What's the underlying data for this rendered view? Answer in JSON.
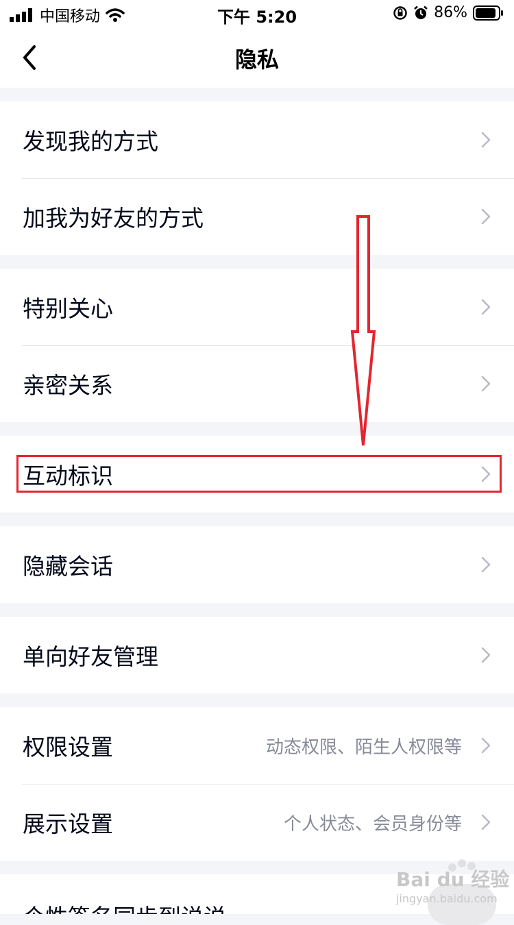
{
  "status_bar": {
    "carrier": "中国移动",
    "time": "下午 5:20",
    "battery": "86%"
  },
  "nav": {
    "title": "隐私"
  },
  "groups": [
    {
      "items": [
        {
          "label": "发现我的方式"
        },
        {
          "label": "加我为好友的方式"
        }
      ]
    },
    {
      "items": [
        {
          "label": "特别关心"
        },
        {
          "label": "亲密关系"
        }
      ]
    },
    {
      "items": [
        {
          "label": "互动标识"
        }
      ]
    },
    {
      "items": [
        {
          "label": "隐藏会话"
        }
      ]
    },
    {
      "items": [
        {
          "label": "单向好友管理"
        }
      ]
    },
    {
      "items": [
        {
          "label": "权限设置",
          "detail": "动态权限、陌生人权限等"
        },
        {
          "label": "展示设置",
          "detail": "个人状态、会员身份等"
        }
      ]
    },
    {
      "items": [
        {
          "label": "个性签名同步到说说"
        }
      ]
    }
  ],
  "watermark": {
    "brand": "Bai du 经验",
    "url": "jingyan.baidu.com"
  },
  "colors": {
    "annotation_red": "#e4252f",
    "background": "#f4f5f9",
    "chevron": "#b8bac4",
    "secondary_text": "#878b99"
  }
}
